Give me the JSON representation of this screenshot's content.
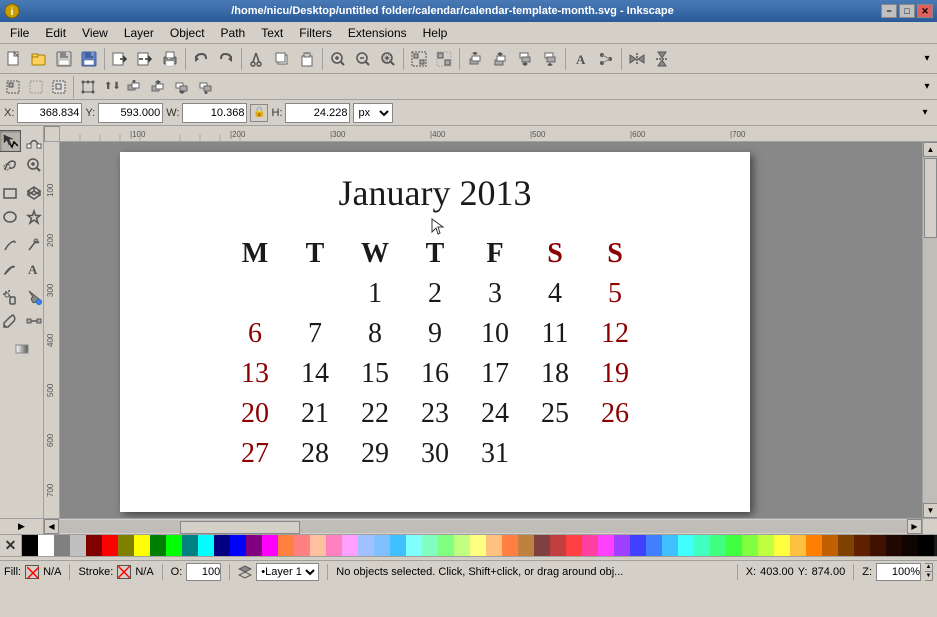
{
  "titlebar": {
    "title": "/home/nicu/Desktop/untitled folder/calendar/calendar-template-month.svg - Inkscape",
    "minimize": "−",
    "maximize": "□",
    "close": "✕"
  },
  "menu": {
    "items": [
      "File",
      "Edit",
      "View",
      "Layer",
      "Object",
      "Path",
      "Text",
      "Filters",
      "Extensions",
      "Help"
    ]
  },
  "toolbar1": {
    "buttons": [
      "new",
      "open",
      "save-template",
      "save",
      "import",
      "export",
      "print",
      "cut-preview",
      "copy",
      "paste",
      "undo",
      "redo",
      "duplicate",
      "cut",
      "copy2",
      "paste2",
      "zoom-in",
      "zoom-out",
      "zoom-fit",
      "node-select",
      "select",
      "group",
      "ungroup",
      "raise",
      "lower",
      "flip-h",
      "flip-v",
      "rotate-cw",
      "rotate-ccw",
      "align"
    ]
  },
  "toolbar2": {
    "buttons": [
      "select-all",
      "select-same",
      "transform",
      "node-edit",
      "node-break",
      "node-join",
      "node-segment",
      "segment-line",
      "segment-curve",
      "node-cusp",
      "node-smooth",
      "node-symmetric",
      "node-auto"
    ]
  },
  "coords": {
    "x_label": "X:",
    "x_value": "368.834",
    "y_label": "Y:",
    "y_value": "593.000",
    "w_label": "W:",
    "w_value": "10.368",
    "h_label": "H:",
    "h_value": "24.228",
    "unit": "px",
    "lock": "🔒"
  },
  "tools": [
    {
      "name": "selector",
      "icon": "↖"
    },
    {
      "name": "node-tool",
      "icon": "◈"
    },
    {
      "name": "tweak-tool",
      "icon": "⌇"
    },
    {
      "name": "zoom-tool",
      "icon": "🔍"
    },
    {
      "name": "rect-tool",
      "icon": "□"
    },
    {
      "name": "3d-box-tool",
      "icon": "⬡"
    },
    {
      "name": "circle-tool",
      "icon": "○"
    },
    {
      "name": "star-tool",
      "icon": "★"
    },
    {
      "name": "pencil-tool",
      "icon": "✏"
    },
    {
      "name": "pen-tool",
      "icon": "🖊"
    },
    {
      "name": "callig-tool",
      "icon": "✒"
    },
    {
      "name": "text-tool",
      "icon": "A"
    },
    {
      "name": "spray-tool",
      "icon": "⦾"
    },
    {
      "name": "fill-tool",
      "icon": "🪣"
    },
    {
      "name": "eyedrop-tool",
      "icon": "💧"
    },
    {
      "name": "connector-tool",
      "icon": "—"
    },
    {
      "name": "gradient-tool",
      "icon": "▨"
    }
  ],
  "calendar": {
    "title": "January 2013",
    "headers": [
      {
        "label": "M",
        "weekend": false
      },
      {
        "label": "T",
        "weekend": false
      },
      {
        "label": "W",
        "weekend": false
      },
      {
        "label": "T",
        "weekend": false
      },
      {
        "label": "F",
        "weekend": false
      },
      {
        "label": "S",
        "weekend": true
      },
      {
        "label": "S",
        "weekend": true
      }
    ],
    "weeks": [
      [
        "",
        "",
        "1",
        "2",
        "3",
        "4",
        "5",
        "6"
      ],
      [
        "7",
        "8",
        "9",
        "10",
        "11",
        "12",
        "13"
      ],
      [
        "14",
        "15",
        "16",
        "17",
        "18",
        "19",
        "20"
      ],
      [
        "21",
        "22",
        "23",
        "24",
        "25",
        "26",
        "27"
      ],
      [
        "28",
        "29",
        "30",
        "31",
        "",
        "",
        ""
      ]
    ]
  },
  "layers": {
    "label": "•Layer 1"
  },
  "statusbar": {
    "fill_label": "Fill:",
    "fill_value": "N/A",
    "stroke_label": "Stroke:",
    "stroke_value": "N/A",
    "opacity_label": "O:",
    "opacity_value": "100",
    "status_text": "No objects selected. Click, Shift+click, or drag around obj...",
    "x_label": "X:",
    "x_value": "403.00",
    "y_label": "Y:",
    "y_value": "874.00",
    "zoom_label": "Z:",
    "zoom_value": "100%"
  },
  "palette": {
    "colors": [
      "#000000",
      "#ffffff",
      "#808080",
      "#c0c0c0",
      "#800000",
      "#ff0000",
      "#808000",
      "#ffff00",
      "#008000",
      "#00ff00",
      "#008080",
      "#00ffff",
      "#000080",
      "#0000ff",
      "#800080",
      "#ff00ff",
      "#ff8040",
      "#ff8080",
      "#ffc0a0",
      "#ff80c0",
      "#ffa0ff",
      "#a0c0ff",
      "#80c0ff",
      "#40c0ff",
      "#80ffff",
      "#80ffc0",
      "#80ff80",
      "#c0ff80",
      "#ffff80",
      "#ffc080",
      "#ff8040",
      "#c08040",
      "#804040",
      "#c04040",
      "#ff4040",
      "#ff40a0",
      "#ff40ff",
      "#a040ff",
      "#4040ff",
      "#4080ff",
      "#40c0ff",
      "#40ffff",
      "#40ffc0",
      "#40ff80",
      "#40ff40",
      "#80ff40",
      "#c0ff40",
      "#ffff40",
      "#ffc040",
      "#ff8000",
      "#c06000",
      "#804000",
      "#602000",
      "#401000",
      "#200800",
      "#100400",
      "#000000",
      "#1a1a1a",
      "#333333",
      "#4d4d4d",
      "#666666",
      "#808080",
      "#999999",
      "#b3b3b3"
    ]
  }
}
